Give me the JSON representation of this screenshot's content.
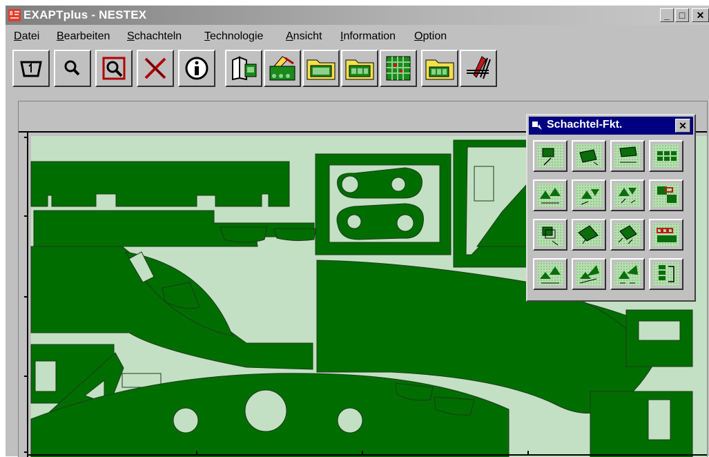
{
  "window": {
    "title": "EXAPTplus - NESTEX"
  },
  "window_controls": {
    "minimize": "_",
    "maximize": "□",
    "close": "✕"
  },
  "menu": {
    "items": [
      {
        "label": "Datei",
        "mnemonic": "D"
      },
      {
        "label": "Bearbeiten",
        "mnemonic": "B"
      },
      {
        "label": "Schachteln",
        "mnemonic": "S"
      },
      {
        "label": "Technologie",
        "mnemonic": "T"
      },
      {
        "label": "Ansicht",
        "mnemonic": "A"
      },
      {
        "label": "Information",
        "mnemonic": "I"
      },
      {
        "label": "Option",
        "mnemonic": "O"
      }
    ]
  },
  "toolbar": {
    "buttons": [
      {
        "icon": "zoom-window-icon"
      },
      {
        "icon": "magnifier-icon"
      },
      {
        "icon": "zoom-box-icon"
      },
      {
        "icon": "delete-cross-icon"
      },
      {
        "icon": "info-icon"
      },
      {
        "icon": "book-icon"
      },
      {
        "icon": "machine-tool-icon"
      },
      {
        "icon": "folder-sheet-icon"
      },
      {
        "icon": "folder-parts-icon"
      },
      {
        "icon": "grid-parts-icon"
      },
      {
        "icon": "folder-parts-small-icon"
      },
      {
        "icon": "laser-cutter-icon"
      }
    ]
  },
  "palette": {
    "title": "Schachtel-Fkt.",
    "close": "✕",
    "buttons": [
      "place-part-icon",
      "rotate-part-icon",
      "move-rotate-icon",
      "grid-array-icon",
      "place-pair-icon",
      "mirror-pair-icon",
      "rotate-pair-icon",
      "group-mark-icon",
      "copy-part-icon",
      "shift-part-icon",
      "turn-part-icon",
      "row-fill-icon",
      "auto-place-icon",
      "auto-rotate-icon",
      "auto-turn-icon",
      "list-sort-icon"
    ]
  },
  "colors": {
    "part": "#006d00",
    "sheet": "#c4e0c4",
    "titlebar": "#000080",
    "face": "#c0c0c0"
  }
}
